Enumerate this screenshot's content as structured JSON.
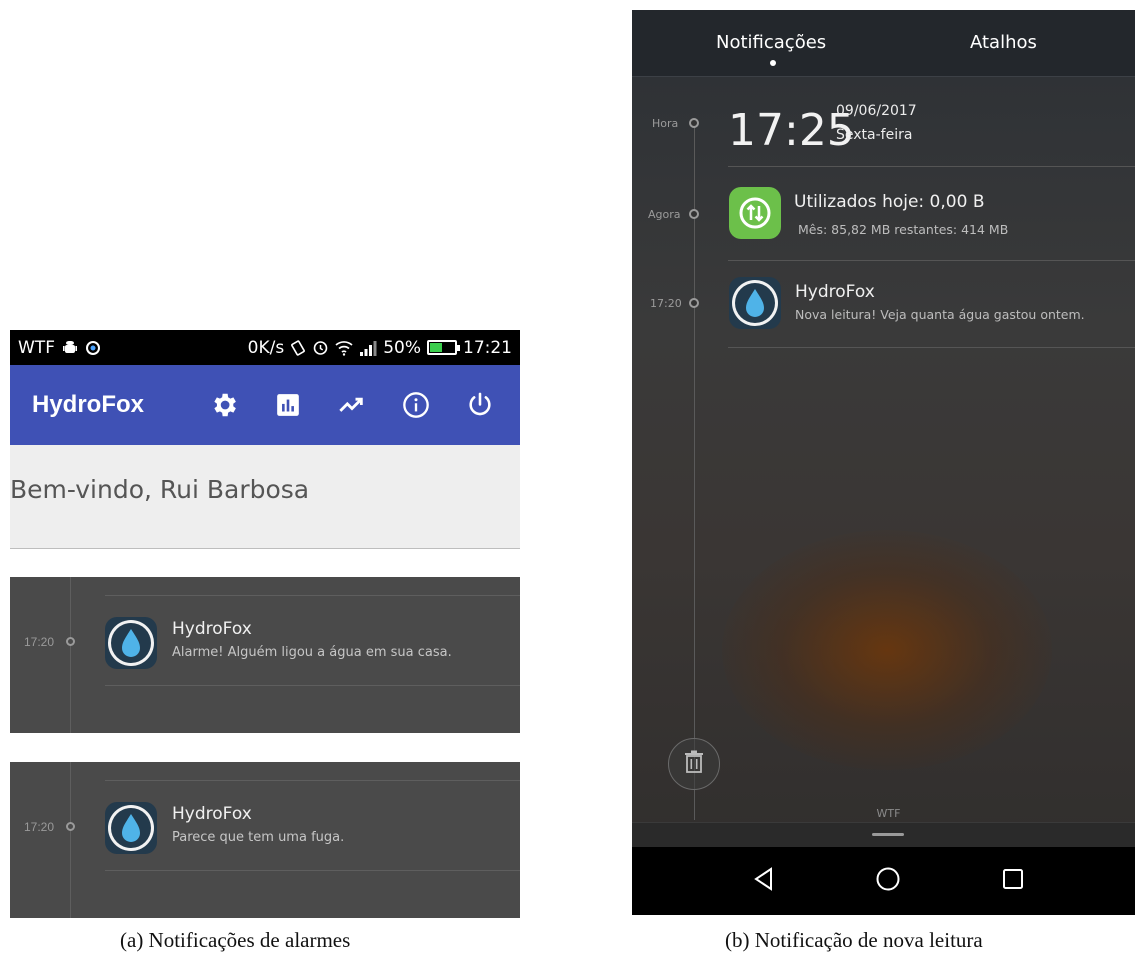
{
  "left": {
    "status_bar": {
      "carrier": "WTF",
      "speed": "0K/s",
      "battery": "50%",
      "battery_level": 0.5,
      "time": "17:21"
    },
    "app_bar": {
      "title": "HydroFox",
      "actions": [
        "settings-icon",
        "bar-chart-icon",
        "trending-up-icon",
        "info-icon",
        "power-icon"
      ],
      "color": "#3f51b5"
    },
    "welcome": "Bem-vindo, Rui Barbosa",
    "notifications": [
      {
        "time": "17:20",
        "app": "HydroFox",
        "text": "Alarme! Alguém ligou a água em sua casa."
      },
      {
        "time": "17:20",
        "app": "HydroFox",
        "text": "Parece que tem uma fuga."
      }
    ],
    "caption": "(a) Notificações de alarmes"
  },
  "right": {
    "tabs": [
      "Notificações",
      "Atalhos"
    ],
    "timeline": {
      "hora_label": "Hora",
      "clock": "17:25",
      "date": "09/06/2017",
      "weekday": "Sexta-feira"
    },
    "data_usage": {
      "time_label": "Agora",
      "title": "Utilizados hoje: 0,00 B",
      "body": "Mês: 85,82 MB restantes: 414 MB",
      "icon_color": "#6cc04a"
    },
    "app_notification": {
      "time": "17:20",
      "app": "HydroFox",
      "text": "Nova leitura! Veja quanta água gastou ontem."
    },
    "carrier": "WTF",
    "caption": "(b) Notificação de nova leitura"
  }
}
